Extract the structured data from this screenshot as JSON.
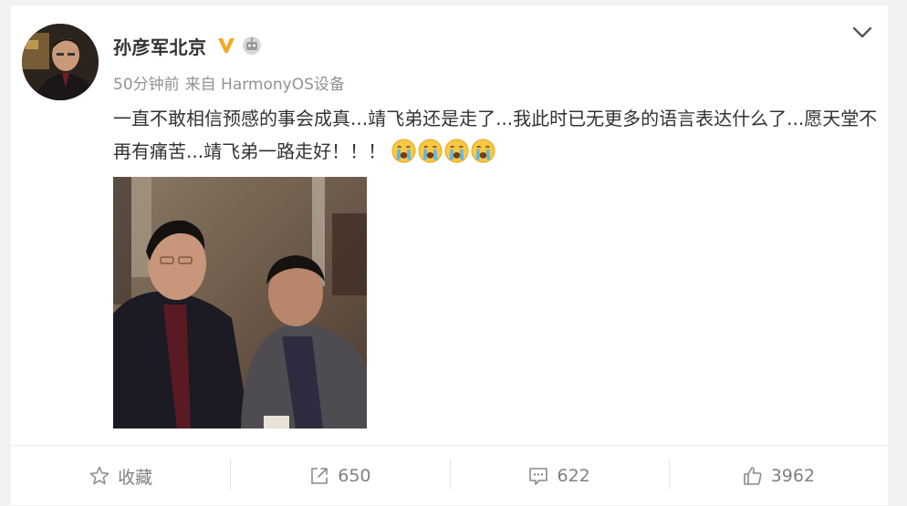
{
  "post": {
    "author": "孙彦军北京",
    "meta_time": "50分钟前",
    "meta_source": "来自 HarmonyOS设备",
    "text": "一直不敢相信预感的事会成真...靖飞弟还是走了...我此时已无更多的语言表达什么了...愿天堂不再有痛苦...靖飞弟一路走好！！！",
    "emojis": [
      "crying-emoji",
      "crying-emoji",
      "crying-emoji",
      "crying-emoji"
    ]
  },
  "actions": {
    "favorite_label": "收藏",
    "repost_count": "650",
    "comment_count": "622",
    "like_count": "3962"
  },
  "colors": {
    "verified": "#f6a623",
    "meta_text": "#939393",
    "action_text": "#808080"
  }
}
